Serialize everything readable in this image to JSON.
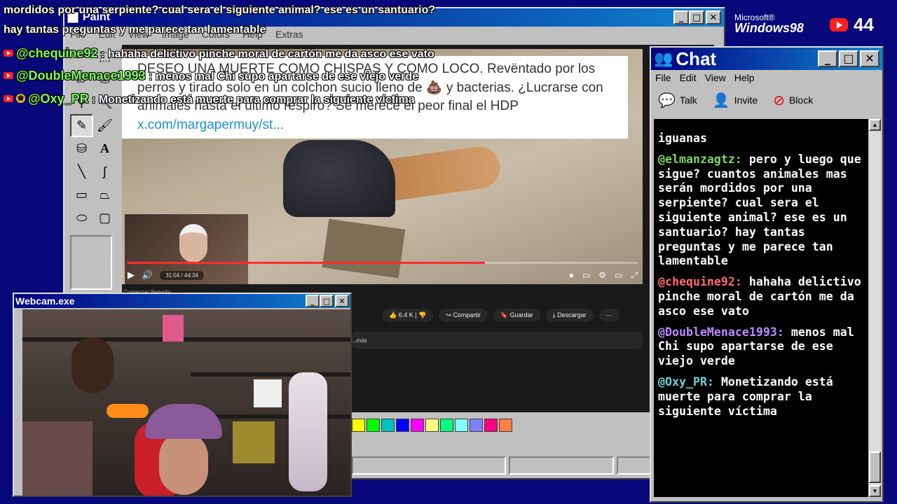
{
  "paint": {
    "title": "Paint",
    "menu": [
      "File",
      "Edit",
      "View",
      "Image",
      "Colors",
      "Help",
      "Extras"
    ],
    "palette": [
      "#ffff00",
      "#00ff00",
      "#00c0c0",
      "#0000ff",
      "#ff00ff",
      "#ffff80",
      "#00ff80",
      "#80ffff",
      "#8080ff",
      "#ff0080",
      "#ff8040"
    ]
  },
  "video": {
    "tweet_text": "DESEO UNA MUERTE COMO CHISPAS Y COMO LOCO. Revëntado por los perros y tirado solo en un colchon sucio lleno de",
    "tweet_emoji": "💩",
    "tweet_text2": "y bacterias. ¿Lucrarse con animales hasta el último respiro? Se merece el peor final el HDP",
    "tweet_link": "x.com/margapermuy/st...",
    "time": "31:04 / 44:34",
    "progress": 0.7,
    "below_text": "Comenzar llamada",
    "likes": "6.4 K",
    "share": "Compartir",
    "save": "Guardar",
    "download": "Descargar",
    "desc_more": "...más"
  },
  "webcam": {
    "title": "Webcam.exe"
  },
  "chat": {
    "title": "Chat",
    "menu": [
      "File",
      "Edit",
      "View",
      "Help"
    ],
    "toolbar": {
      "talk": "Talk",
      "invite": "Invite",
      "block": "Block"
    },
    "messages": [
      {
        "user": "",
        "color": "#ffffff",
        "text": "iguanas"
      },
      {
        "user": "@elmanzagtz:",
        "color": "#7fd46b",
        "text": "pero y luego que sigue? cuantos animales mas serán mordidos por una serpiente? cual sera el siguiente animal? ese es un santuario? hay tantas preguntas y me parece tan lamentable"
      },
      {
        "user": "@chequine92:",
        "color": "#ff6b6b",
        "text": "hahaha delictivo pinche moral de cartón me da asco ese vato"
      },
      {
        "user": "@DoubleMenace1993:",
        "color": "#b98bff",
        "text": "menos mal Chi supo apartarse de ese viejo verde"
      },
      {
        "user": "@Oxy_PR:",
        "color": "#6fd0d6",
        "text": "Monetizando está muerte para comprar la siguiente víctima"
      }
    ]
  },
  "overlay": {
    "line1": "mordidos por una serpiente? cual sera el siguiente animal? ese es un santuario?",
    "line2": "hay tantas preguntas y me parece tan lamentable",
    "alerts": [
      {
        "user": "@chequine92",
        "text": "hahaha delictivo pinche moral de cartón me da asco ese vato",
        "star": false
      },
      {
        "user": "@DoubleMenace1993",
        "text": "menos mal Chi supo apartarse de ese viejo verde",
        "star": false
      },
      {
        "user": "@Oxy_PR",
        "text": "Monetizando está muerte para comprar la siguiente víctima",
        "star": true
      }
    ]
  },
  "brand": {
    "microsoft": "Microsoft®",
    "windows": "Windows98"
  },
  "viewers": {
    "count": "44"
  }
}
